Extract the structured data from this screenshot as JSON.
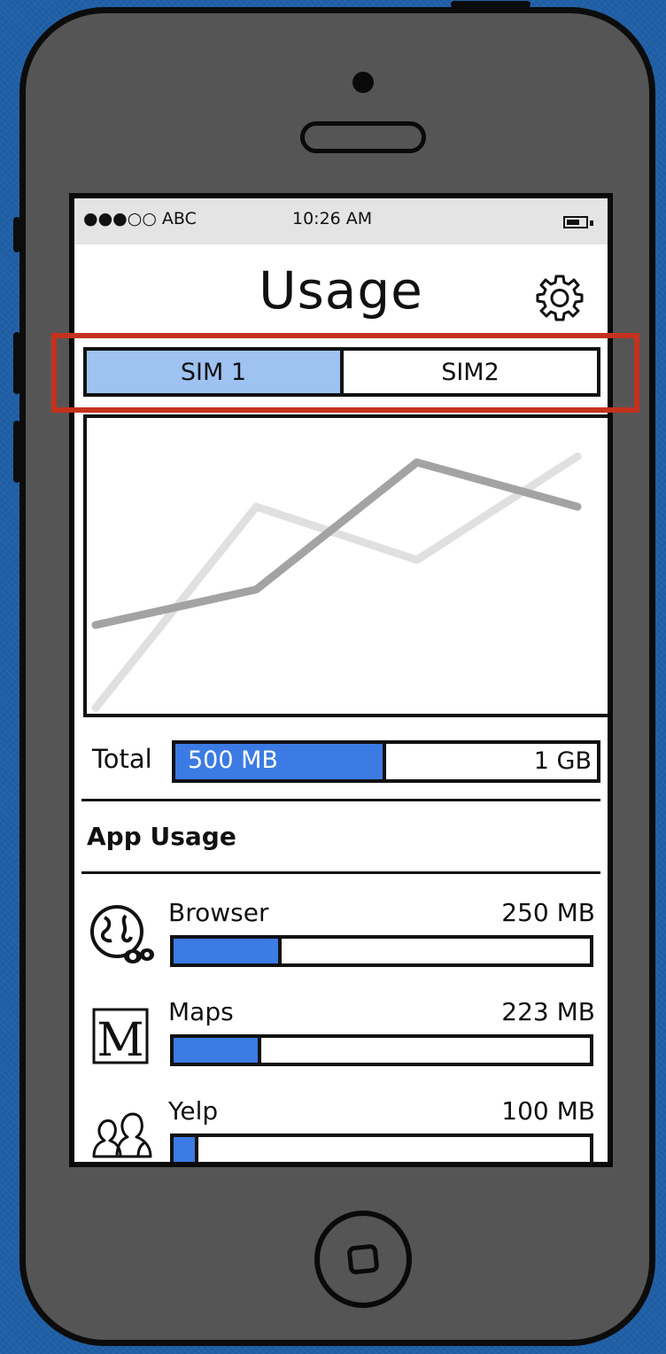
{
  "status_bar": {
    "carrier": "●●●○○ ABC",
    "time": "10:26 AM",
    "battery_icon": "battery-icon"
  },
  "header": {
    "title": "Usage",
    "settings_icon": "gear-icon"
  },
  "sim_tabs": [
    {
      "label": "SIM 1",
      "active": true
    },
    {
      "label": "SIM2",
      "active": false
    }
  ],
  "chart_data": {
    "type": "line",
    "x": [
      0,
      1,
      2,
      3
    ],
    "series": [
      {
        "values": [
          0.3,
          0.42,
          0.85,
          0.7
        ],
        "color": "#a3a3a3"
      },
      {
        "values": [
          0.02,
          0.7,
          0.52,
          0.87
        ],
        "color": "#e0e0e0"
      }
    ],
    "ylim": [
      0,
      1
    ],
    "grid": false,
    "title": "",
    "xlabel": "",
    "ylabel": ""
  },
  "total": {
    "label": "Total",
    "used": "500 MB",
    "max": "1 GB",
    "fraction": 0.5
  },
  "app_usage": {
    "title": "App Usage",
    "apps": [
      {
        "name": "Browser",
        "size": "250 MB",
        "fraction": 0.26,
        "icon": "globe-icon"
      },
      {
        "name": "Maps",
        "size": "223 MB",
        "fraction": 0.21,
        "icon": "map-m-icon"
      },
      {
        "name": "Yelp",
        "size": "100 MB",
        "fraction": 0.06,
        "icon": "people-icon"
      }
    ]
  },
  "colors": {
    "accent": "#3b7be3",
    "tab_active": "#9ec2f2",
    "highlight": "#c4321e"
  }
}
